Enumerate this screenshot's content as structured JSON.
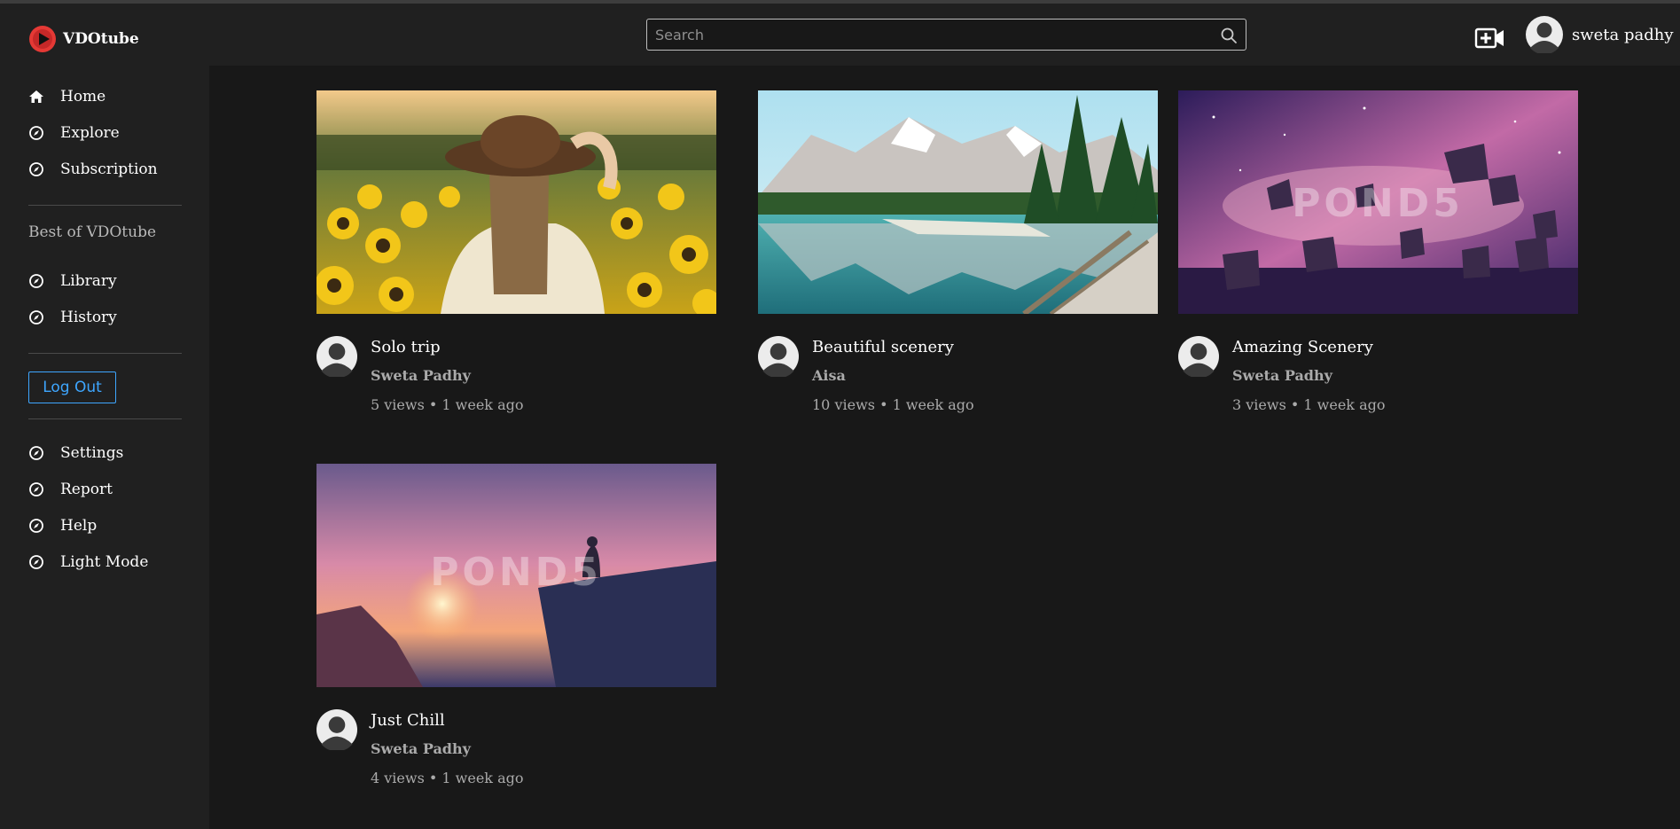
{
  "app": {
    "name": "VDOtube"
  },
  "colors": {
    "background": "#181818",
    "panel": "#202020",
    "accent": "#3ea6ff",
    "logo": "#e53935"
  },
  "search": {
    "placeholder": "Search",
    "value": ""
  },
  "header": {
    "upload_icon": "add-video-icon",
    "user_name": "sweta padhy"
  },
  "sidebar": {
    "primary": [
      {
        "label": "Home",
        "icon": "home-icon"
      },
      {
        "label": "Explore",
        "icon": "compass-icon"
      },
      {
        "label": "Subscription",
        "icon": "compass-icon"
      }
    ],
    "section_title": "Best of VDOtube",
    "secondary": [
      {
        "label": "Library",
        "icon": "compass-icon"
      },
      {
        "label": "History",
        "icon": "compass-icon"
      }
    ],
    "logout_label": "Log Out",
    "tertiary": [
      {
        "label": "Settings",
        "icon": "compass-icon"
      },
      {
        "label": "Report",
        "icon": "compass-icon"
      },
      {
        "label": "Help",
        "icon": "compass-icon"
      },
      {
        "label": "Light Mode",
        "icon": "compass-icon"
      }
    ]
  },
  "videos": [
    {
      "title": "Solo trip",
      "channel": "Sweta Padhy",
      "stats": "5 views • 1 week ago",
      "thumbnail": "woman in hat in sunflower field"
    },
    {
      "title": "Beautiful scenery",
      "channel": "Aisa",
      "stats": "10 views • 1 week ago",
      "thumbnail": "mountain lake with trees"
    },
    {
      "title": "Amazing Scenery",
      "channel": "Sweta Padhy",
      "stats": "3 views • 1 week ago",
      "thumbnail": "floating rocks in purple sky",
      "watermark": "POND5"
    },
    {
      "title": "Just Chill",
      "channel": "Sweta Padhy",
      "stats": "4 views • 1 week ago",
      "thumbnail": "person on cliff at sunset",
      "watermark": "POND5"
    }
  ]
}
